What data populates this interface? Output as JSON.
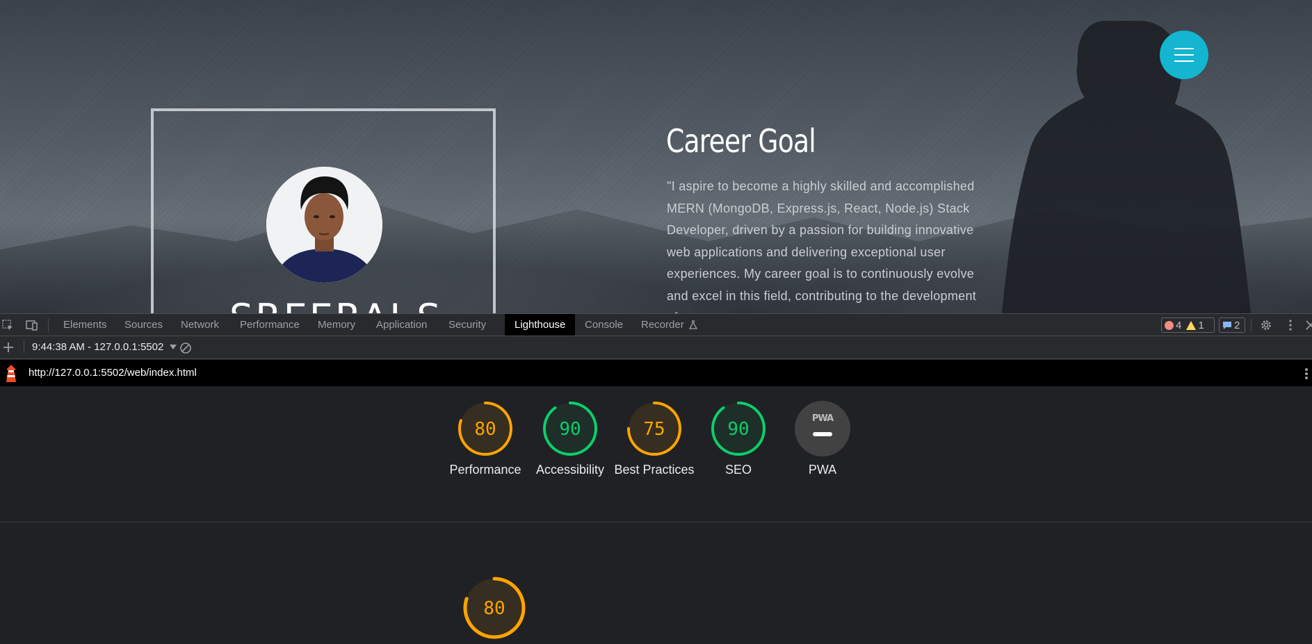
{
  "site": {
    "name_partial": "SREERAJ S",
    "career_title": "Career Goal",
    "career_text": "\"I aspire to become a highly skilled and accomplished MERN (MongoDB, Express.js, React, Node.js) Stack Developer, driven by a passion for building innovative web applications and delivering exceptional user experiences. My career goal is to continuously evolve and excel in this field, contributing to the development of",
    "accent_color": "#13b5d0"
  },
  "devtools": {
    "tabs": [
      "Elements",
      "Sources",
      "Network",
      "Performance",
      "Memory",
      "Application",
      "Security",
      "Lighthouse",
      "Console",
      "Recorder"
    ],
    "active_tab": "Lighthouse",
    "errors": "4",
    "warnings": "1",
    "messages": "2",
    "report_selector": "9:44:38 AM - 127.0.0.1:5502",
    "url": "http://127.0.0.1:5502/web/index.html",
    "scores": [
      {
        "label": "Performance",
        "value": "80",
        "status": "average"
      },
      {
        "label": "Accessibility",
        "value": "90",
        "status": "pass"
      },
      {
        "label": "Best Practices",
        "value": "75",
        "status": "average"
      },
      {
        "label": "SEO",
        "value": "90",
        "status": "pass"
      },
      {
        "label": "PWA",
        "value": "PWA",
        "status": "na"
      }
    ],
    "section_score": "80",
    "colors": {
      "average": "#ffa400",
      "pass": "#0cce6b",
      "na": "#5f6368"
    }
  }
}
